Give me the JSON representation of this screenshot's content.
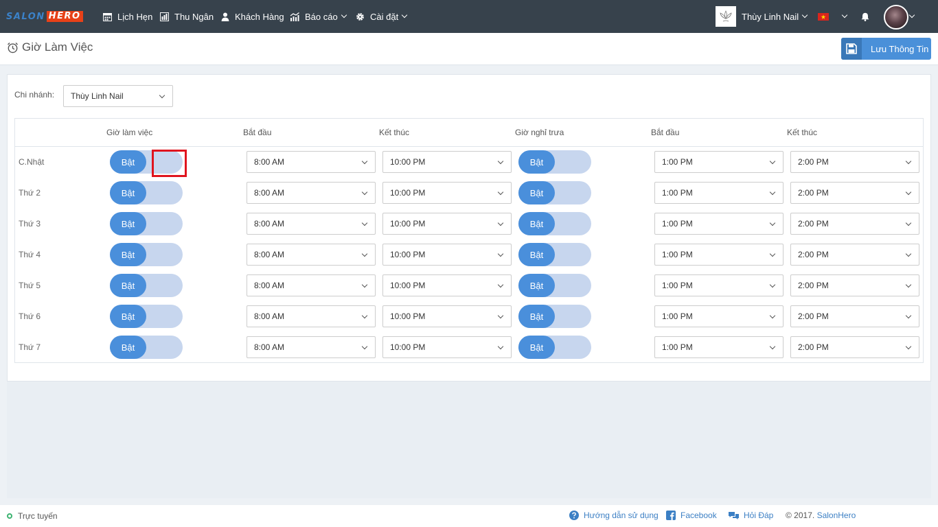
{
  "brand": {
    "part1": "SALON",
    "part2": "HERO"
  },
  "nav": {
    "appointments": "Lịch Hẹn",
    "cashier": "Thu Ngân",
    "customers": "Khách Hàng",
    "reports": "Báo cáo",
    "settings": "Cài đặt",
    "store_name": "Thùy Linh Nail"
  },
  "page": {
    "title": "Giờ Làm Việc",
    "save_label": "Lưu Thông Tin"
  },
  "branch": {
    "label": "Chi nhánh:",
    "value": "Thùy Linh Nail"
  },
  "table": {
    "headers": {
      "work_hours": "Giờ làm việc",
      "start": "Bắt đầu",
      "end": "Kết thúc",
      "lunch_break": "Giờ nghỉ trưa",
      "lunch_start": "Bắt đầu",
      "lunch_end": "Kết thúc"
    },
    "rows": [
      {
        "day": "C.Nhật",
        "work_toggle": "Bật",
        "start": "8:00 AM",
        "end": "10:00 PM",
        "lunch_toggle": "Bật",
        "lunch_start": "1:00 PM",
        "lunch_end": "2:00 PM"
      },
      {
        "day": "Thứ 2",
        "work_toggle": "Bật",
        "start": "8:00 AM",
        "end": "10:00 PM",
        "lunch_toggle": "Bật",
        "lunch_start": "1:00 PM",
        "lunch_end": "2:00 PM"
      },
      {
        "day": "Thứ 3",
        "work_toggle": "Bật",
        "start": "8:00 AM",
        "end": "10:00 PM",
        "lunch_toggle": "Bật",
        "lunch_start": "1:00 PM",
        "lunch_end": "2:00 PM"
      },
      {
        "day": "Thứ 4",
        "work_toggle": "Bật",
        "start": "8:00 AM",
        "end": "10:00 PM",
        "lunch_toggle": "Bật",
        "lunch_start": "1:00 PM",
        "lunch_end": "2:00 PM"
      },
      {
        "day": "Thứ 5",
        "work_toggle": "Bật",
        "start": "8:00 AM",
        "end": "10:00 PM",
        "lunch_toggle": "Bật",
        "lunch_start": "1:00 PM",
        "lunch_end": "2:00 PM"
      },
      {
        "day": "Thứ 6",
        "work_toggle": "Bật",
        "start": "8:00 AM",
        "end": "10:00 PM",
        "lunch_toggle": "Bật",
        "lunch_start": "1:00 PM",
        "lunch_end": "2:00 PM"
      },
      {
        "day": "Thứ 7",
        "work_toggle": "Bật",
        "start": "8:00 AM",
        "end": "10:00 PM",
        "lunch_toggle": "Bật",
        "lunch_start": "1:00 PM",
        "lunch_end": "2:00 PM"
      }
    ]
  },
  "footer": {
    "status": "Trực tuyến",
    "help": "Hướng dẫn sử dụng",
    "facebook": "Facebook",
    "qa": "Hỏi Đáp",
    "copyright": "© 2017.",
    "copyright_brand": "SalonHero"
  },
  "colors": {
    "navbar": "#37424c",
    "accent": "#4a8fdb",
    "toggle_track": "#c7d6ee",
    "highlight": "#e0141e"
  }
}
